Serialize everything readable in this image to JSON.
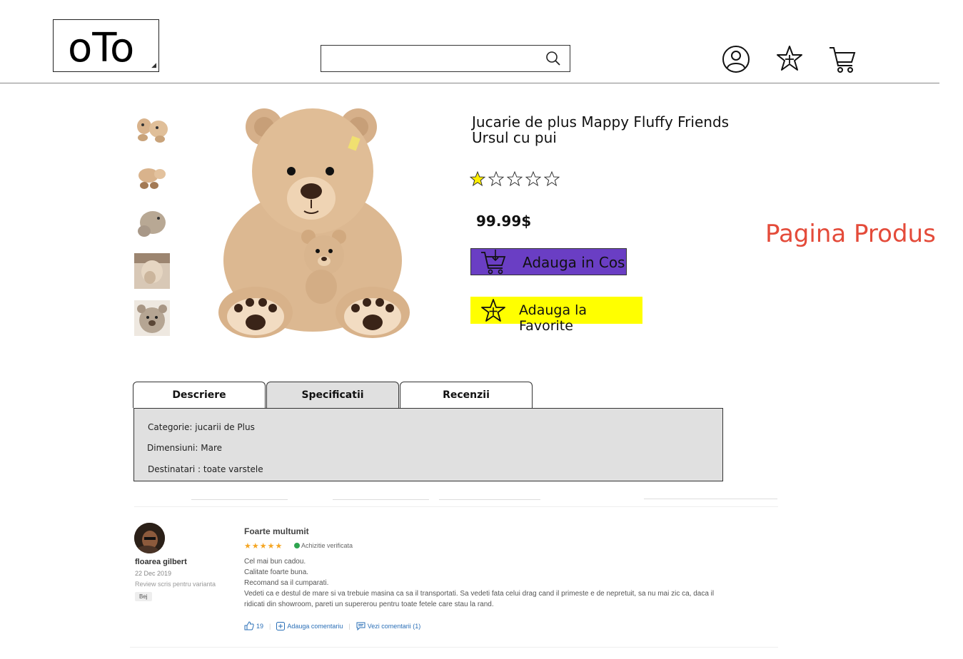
{
  "header": {
    "logo": "oTo",
    "search_placeholder": "",
    "icons": [
      "user-icon",
      "favorites-star-icon",
      "cart-icon"
    ]
  },
  "gallery": {
    "thumbnails": [
      "teddy-thumb-1",
      "teddy-thumb-2",
      "teddy-thumb-3",
      "teddy-thumb-4",
      "teddy-thumb-5"
    ],
    "main_image": "teddy-bear-with-cub"
  },
  "product": {
    "title_line1": "Jucarie de plus Mappy Fluffy Friends",
    "title_line2": "Ursul cu pui",
    "rating": 1,
    "rating_max": 5,
    "price": "99.99$",
    "add_to_cart": "Adauga in Cos",
    "add_to_favorites": "Adauga la Favorite"
  },
  "page_label": "Pagina Produs",
  "tabs": {
    "items": [
      {
        "label": "Descriere",
        "active": false
      },
      {
        "label": "Specificatii",
        "active": true
      },
      {
        "label": "Recenzii",
        "active": false
      }
    ]
  },
  "specs": {
    "categorie": "Categorie: jucarii de Plus",
    "dimensiuni": "Dimensiuni: Mare",
    "destinatari": "Destinatari : toate varstele"
  },
  "review": {
    "author": "floarea gilbert",
    "date": "22 Dec 2019",
    "variant_note": "Review scris pentru varianta",
    "variant": "Bej",
    "title": "Foarte multumit",
    "stars": "★★★★★",
    "verified": "Achizitie verificata",
    "lines": [
      "Cel mai bun cadou.",
      "Calitate foarte buna.",
      "Recomand sa il cumparati.",
      "Vedeti ca e destul de mare si va trebuie masina ca sa il transportati. Sa vedeti fata celui drag cand il primeste e de nepretuit, sa nu mai zic ca, daca il",
      "ridicati din showroom, pareti un supererou pentru toate fetele care stau la rand."
    ],
    "likes": "19",
    "add_comment": "Adauga comentariu",
    "view_comments": "Vezi comentarii (1)"
  },
  "colors": {
    "cart_button": "#6a3ec4",
    "favorite_button": "#ffff00",
    "page_label": "#e44b3a",
    "star_filled": "#ffee00",
    "panel_bg": "#e0e0e0"
  }
}
